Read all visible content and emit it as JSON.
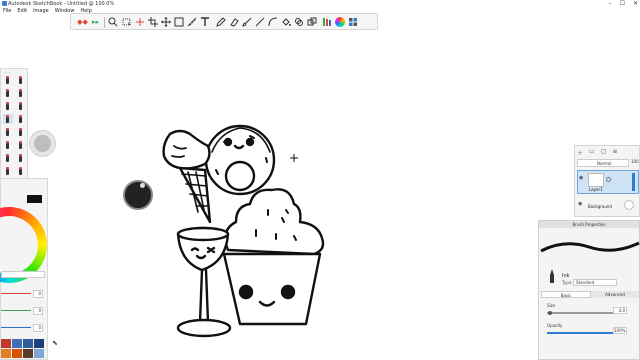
{
  "window": {
    "title": "Autodesk SketchBook - Untitled @ 100.0%",
    "controls": {
      "minimize": "–",
      "maximize": "☐",
      "close": "✕"
    }
  },
  "menu": [
    "File",
    "Edit",
    "Image",
    "Window",
    "Help"
  ],
  "toolbar": {
    "icons": [
      "brand-red-icon",
      "brand-green-icon",
      "zoom-icon",
      "select-icon",
      "transform-icon",
      "crop-icon",
      "move-icon",
      "rectangle-icon",
      "ruler-icon",
      "text-icon",
      "pencil-icon",
      "eraser-icon",
      "brush-icon",
      "line-icon",
      "curve-icon",
      "fill-icon",
      "stamp-icon",
      "perspective-icon",
      "color-palette-icon",
      "color-wheel-icon",
      "layers-icon"
    ]
  },
  "colors": {
    "accent": "#2f7dd1",
    "active_color": "#111111",
    "swatches": [
      "#c0392b",
      "#3f6fb5",
      "#2e5d9a",
      "#1f3f7a",
      "#e67e22",
      "#d35400",
      "#5b3a29",
      "#7fa6d6"
    ]
  },
  "color_editor": {
    "sliders": [
      {
        "name": "red",
        "value": "0",
        "color": "#d9443b"
      },
      {
        "name": "green",
        "value": "0",
        "color": "#3aa357"
      },
      {
        "name": "blue",
        "value": "0",
        "color": "#2f6bd1"
      }
    ]
  },
  "layer_editor": {
    "blend_mode": "Normal",
    "opacity": "100",
    "layers": [
      {
        "name": "Layer1",
        "selected": true
      },
      {
        "name": "Background",
        "selected": false
      }
    ]
  },
  "brush_properties": {
    "title": "Brush Properties",
    "brush_name": "Ink",
    "type_label": "Type:",
    "type_value": "Standard",
    "tabs": [
      "Basic",
      "Advanced"
    ],
    "size_label": "Size",
    "size_value": "4.0",
    "opacity_label": "Opacity",
    "opacity_value": "100%"
  }
}
